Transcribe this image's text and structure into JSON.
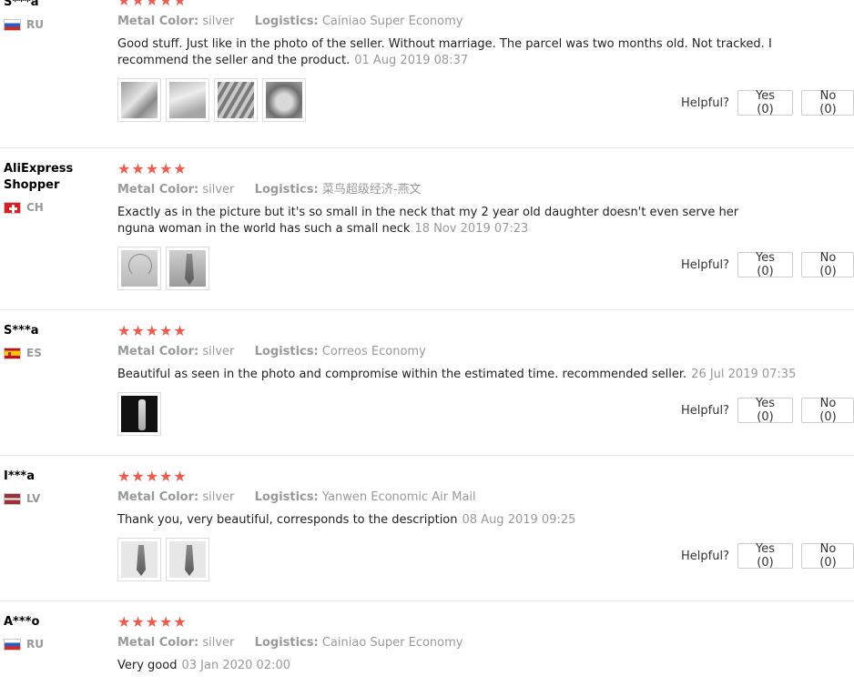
{
  "helpful_label": "Helpful?",
  "labels": {
    "metal_color": "Metal Color:",
    "logistics": "Logistics:"
  },
  "accent_color": "#f05a4f",
  "reviews": [
    {
      "user": "S***a",
      "country": "RU",
      "flag": "russia-flag",
      "rating": 5,
      "stars": "★★★★★",
      "metal_color": "silver",
      "logistics": "Cainiao Super Economy",
      "text": "Good stuff. Just like in the photo of the seller. Without marriage. The parcel was two months old. Not tracked. I recommend the seller and the product.",
      "date": "01 Aug 2019 08:37",
      "photos": 4,
      "yes": "Yes (0)",
      "no": "No (0)"
    },
    {
      "user": "AliExpress Shopper",
      "country": "CH",
      "flag": "switzerland-flag",
      "rating": 5,
      "stars": "★★★★★",
      "metal_color": "silver",
      "logistics": "菜鸟超级经济-燕文",
      "text": "Exactly as in the picture but it's so small in the neck that my 2 year old daughter doesn't even serve her nguna woman in the world has such a small neck",
      "date": "18 Nov 2019 07:23",
      "photos": 2,
      "yes": "Yes (0)",
      "no": "No (0)"
    },
    {
      "user": "S***a",
      "country": "ES",
      "flag": "spain-flag",
      "rating": 5,
      "stars": "★★★★★",
      "metal_color": "silver",
      "logistics": "Correos Economy",
      "text": "Beautiful as seen in the photo and compromise within the estimated time. recommended seller.",
      "date": "26 Jul 2019 07:35",
      "photos": 1,
      "yes": "Yes (0)",
      "no": "No (0)"
    },
    {
      "user": "I***a",
      "country": "LV",
      "flag": "latvia-flag",
      "rating": 5,
      "stars": "★★★★★",
      "metal_color": "silver",
      "logistics": "Yanwen Economic Air Mail",
      "text": "Thank you, very beautiful, corresponds to the description",
      "date": "08 Aug 2019 09:25",
      "photos": 2,
      "yes": "Yes (0)",
      "no": "No (0)"
    },
    {
      "user": "A***o",
      "country": "RU",
      "flag": "russia-flag",
      "rating": 5,
      "stars": "★★★★★",
      "metal_color": "silver",
      "logistics": "Cainiao Super Economy",
      "text": "Very good",
      "date": "03 Jan 2020 02:00",
      "photos": 0
    }
  ]
}
